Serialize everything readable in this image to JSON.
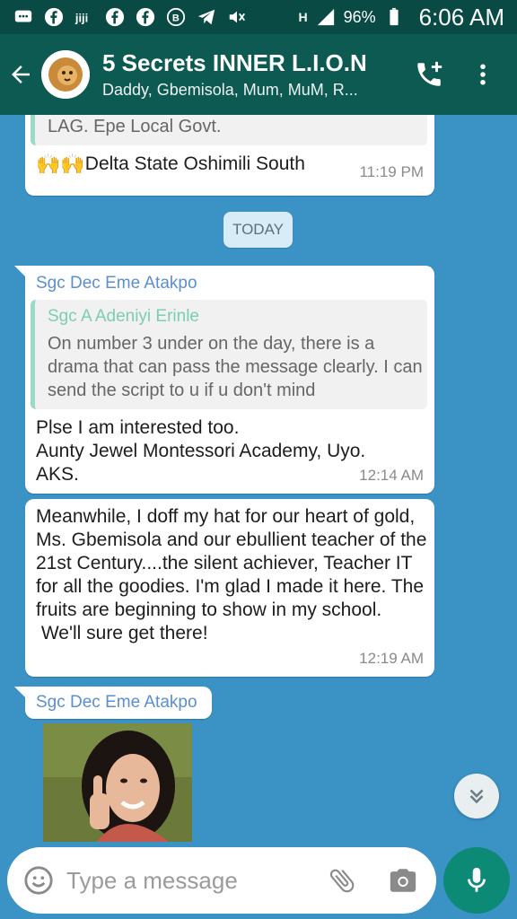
{
  "status_bar": {
    "battery": "96%",
    "time": "6:06 AM",
    "network_label": "H"
  },
  "header": {
    "title": "5 Secrets INNER L.I.O.N",
    "subtitle": "Daddy, Gbemisola, Mum, MuM, R..."
  },
  "messages": {
    "partial": {
      "line1": "LAG. Epe Local Govt.",
      "emoji": "🙌🙌",
      "line2": "Delta State Oshimili South",
      "time": "11:19 PM"
    },
    "day_chip": "TODAY",
    "reply_msg": {
      "sender": "Sgc Dec Eme Atakpo",
      "quote_sender": "Sgc A Adeniyi Erinle",
      "quote_text": "On number 3 under on the day, there is a drama that can pass the message clearly. I can send the script to u if u don't mind",
      "text": "Plse I am interested too.\nAunty Jewel Montessori Academy, Uyo.\nAKS.",
      "time": "12:14 AM"
    },
    "long_msg": {
      "text": "Meanwhile, I doff my hat for our heart of gold, Ms. Gbemisola and our ebullient teacher of the 21st Century....the silent achiever, Teacher IT for all the goodies. I'm glad I made it here. The fruits are beginning to show in my school.\n We'll sure get there!",
      "time": "12:19 AM"
    },
    "image_msg": {
      "sender": "Sgc Dec Eme Atakpo"
    }
  },
  "composer": {
    "placeholder": "Type a message"
  },
  "colors": {
    "header": "#0c5a52",
    "status_bar": "#0a4a44",
    "wallpaper": "#3a92c5",
    "mic_button": "#0c8a76",
    "sender_name": "#5b8fd0",
    "quote_sender": "#7ccdb6"
  }
}
